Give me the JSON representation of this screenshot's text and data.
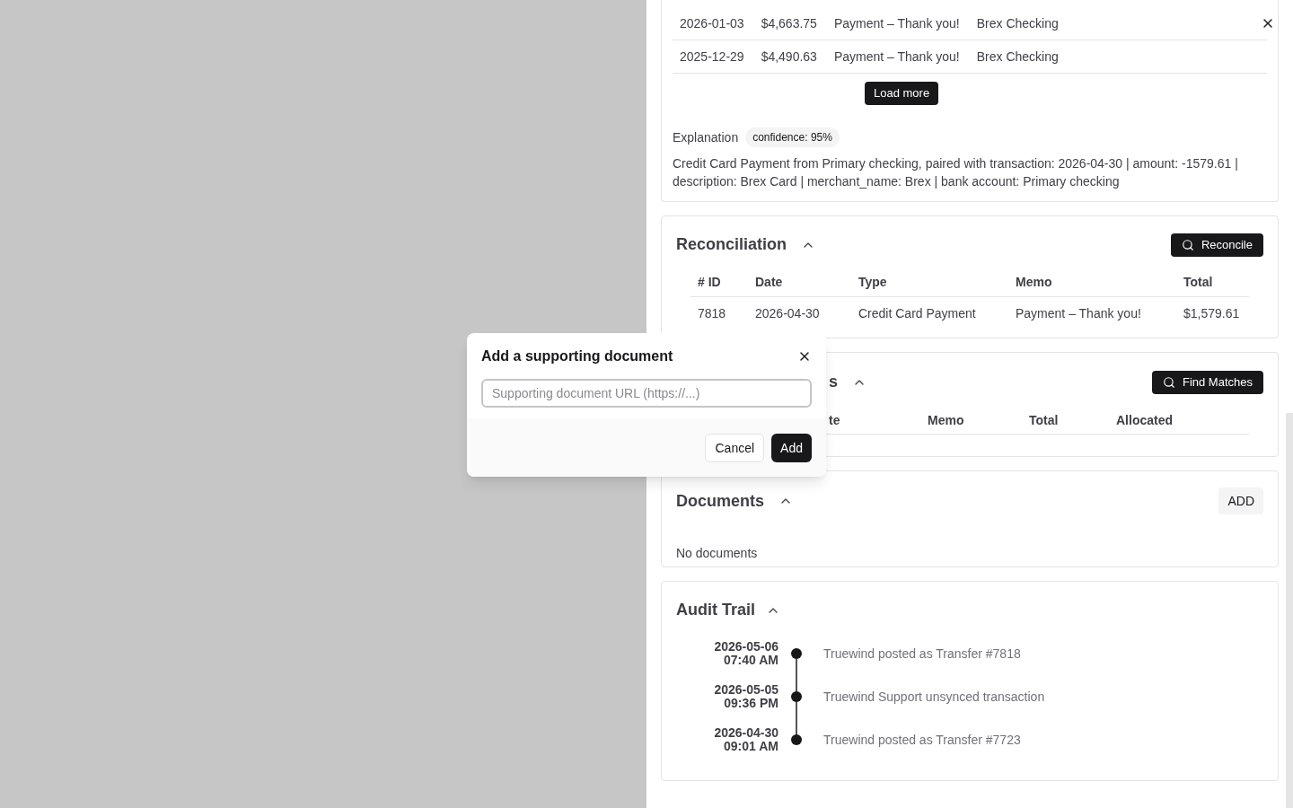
{
  "transactions": {
    "rows": [
      {
        "date": "2026-01-03",
        "amount": "$4,663.75",
        "description": "Payment – Thank you!",
        "account": "Brex Checking"
      },
      {
        "date": "2025-12-29",
        "amount": "$4,490.63",
        "description": "Payment – Thank you!",
        "account": "Brex Checking"
      }
    ],
    "load_more": "Load more"
  },
  "explanation": {
    "label": "Explanation",
    "confidence": "confidence: 95%",
    "text": "Credit Card Payment from Primary checking, paired with transaction: 2026-04-30 | amount: -1579.61 | description: Brex Card | merchant_name: Brex | bank account: Primary checking"
  },
  "reconciliation": {
    "title": "Reconciliation",
    "expanded": true,
    "button": "Reconcile",
    "columns": [
      "# ID",
      "Date",
      "Type",
      "Memo",
      "Total"
    ],
    "rows": [
      [
        "7818",
        "2026-04-30",
        "Credit Card Payment",
        "Payment – Thank you!",
        "$1,579.61"
      ]
    ]
  },
  "matches": {
    "title": "s",
    "expanded": true,
    "button": "Find Matches",
    "columns": [
      "te",
      "Memo",
      "Total",
      "Allocated"
    ]
  },
  "documents": {
    "title": "Documents",
    "expanded": true,
    "button": "ADD",
    "empty": "No documents"
  },
  "audit_trail": {
    "title": "Audit Trail",
    "expanded": true,
    "events": [
      {
        "date": "2026-05-06",
        "time": "07:40 AM",
        "text": "Truewind posted as Transfer #7818"
      },
      {
        "date": "2026-05-05",
        "time": "09:36 PM",
        "text": "Truewind Support unsynced transaction"
      },
      {
        "date": "2026-04-30",
        "time": "09:01 AM",
        "text": "Truewind posted as Transfer #7723"
      }
    ]
  },
  "dialog": {
    "title": "Add a supporting document",
    "placeholder": "Supporting document URL (https://...)",
    "cancel": "Cancel",
    "confirm": "Add"
  }
}
